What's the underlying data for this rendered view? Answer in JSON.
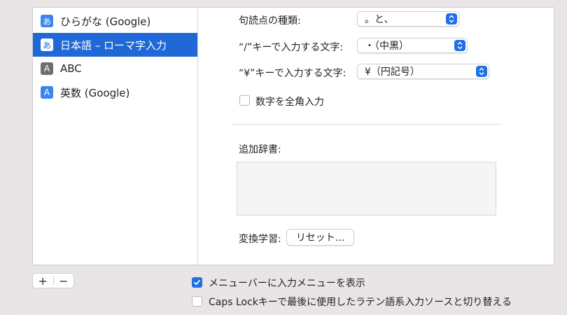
{
  "sources": [
    {
      "label": "ひらがな (Google)",
      "icon": "hiragana-icon",
      "glyph": "あ"
    },
    {
      "label": "日本語 – ローマ字入力",
      "icon": "hiragana-icon",
      "glyph": "あ"
    },
    {
      "label": "ABC",
      "icon": "abc-input-icon",
      "glyph": "A"
    },
    {
      "label": "英数 (Google)",
      "icon": "eisu-icon",
      "glyph": "A"
    }
  ],
  "settings": {
    "punctuation_label": "句読点の種類:",
    "punctuation_value": "。と、",
    "slash_label": "“/”キーで入力する文字:",
    "slash_value": "・（中黒）",
    "yen_label": "“¥”キーで入力する文字:",
    "yen_value": "¥（円記号）",
    "fullwidth_numbers_label": "数字を全角入力",
    "dictionary_label": "追加辞書:",
    "learning_label": "変換学習:",
    "reset_button": "リセット..."
  },
  "bottom": {
    "add": "+",
    "remove": "−",
    "show_input_menu_label": "メニューバーに入力メニューを表示",
    "caps_lock_label": "Caps Lockキーで最後に使用したラテン語系入力ソースと切り替える"
  },
  "colors": {
    "accent": "#1f6fe5",
    "selection": "#1f68d6"
  }
}
